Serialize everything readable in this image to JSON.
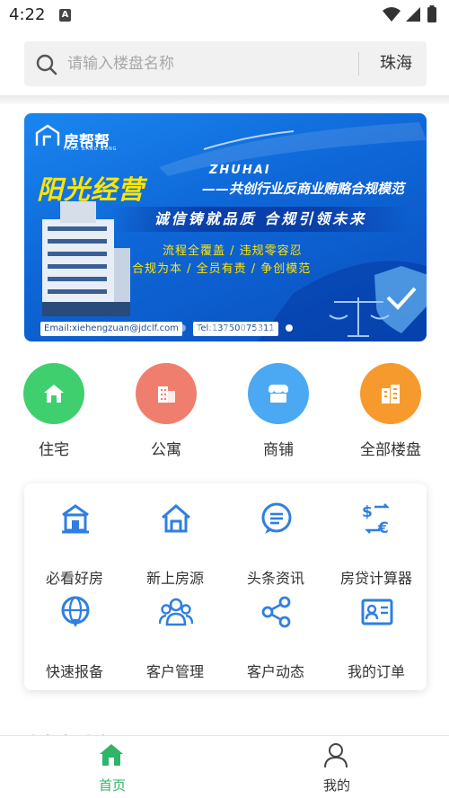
{
  "status_bar": {
    "time": "4:22",
    "notification_icon": "A"
  },
  "search": {
    "placeholder": "请输入楼盘名称",
    "city": "珠海"
  },
  "banner": {
    "brand": "房帮帮",
    "brand_sub": "FANG BANG BANG",
    "city": "ZHUHAI",
    "title": "阳光经营",
    "subtitle": "——共创行业反商业贿赂合规模范",
    "slogan": "诚信铸就品质 合规引领未来",
    "line1": "流程全覆盖 / 违规零容忍",
    "line2": "合规为本 / 全员有责 / 争创模范",
    "email": "Email:xiehengzuan@jdclf.com",
    "tel": "Tel:13750075311",
    "slide_count": 8,
    "active_slide": 8
  },
  "categories": [
    {
      "label": "住宅",
      "icon": "house-icon",
      "color": "#3fcf6f"
    },
    {
      "label": "公寓",
      "icon": "apartment-icon",
      "color": "#f07e6e"
    },
    {
      "label": "商铺",
      "icon": "shop-icon",
      "color": "#4aa9f2"
    },
    {
      "label": "全部楼盘",
      "icon": "buildings-icon",
      "color": "#f79a2e"
    }
  ],
  "services": [
    {
      "label": "必看好房",
      "icon": "house-outline-icon"
    },
    {
      "label": "新上房源",
      "icon": "new-house-icon"
    },
    {
      "label": "头条资讯",
      "icon": "news-bubble-icon"
    },
    {
      "label": "房贷计算器",
      "icon": "currency-exchange-icon"
    },
    {
      "label": "快速报备",
      "icon": "globe-report-icon"
    },
    {
      "label": "客户管理",
      "icon": "customers-icon"
    },
    {
      "label": "客户动态",
      "icon": "share-nodes-icon"
    },
    {
      "label": "我的订单",
      "icon": "order-card-icon"
    }
  ],
  "section_peek": "房帮帮头条",
  "tabbar": {
    "home_label": "首页",
    "mine_label": "我的",
    "active_color": "#2fb567",
    "inactive_color": "#333333"
  },
  "colors": {
    "accent": "#2f7fe0",
    "banner_yellow": "#ffe600"
  }
}
